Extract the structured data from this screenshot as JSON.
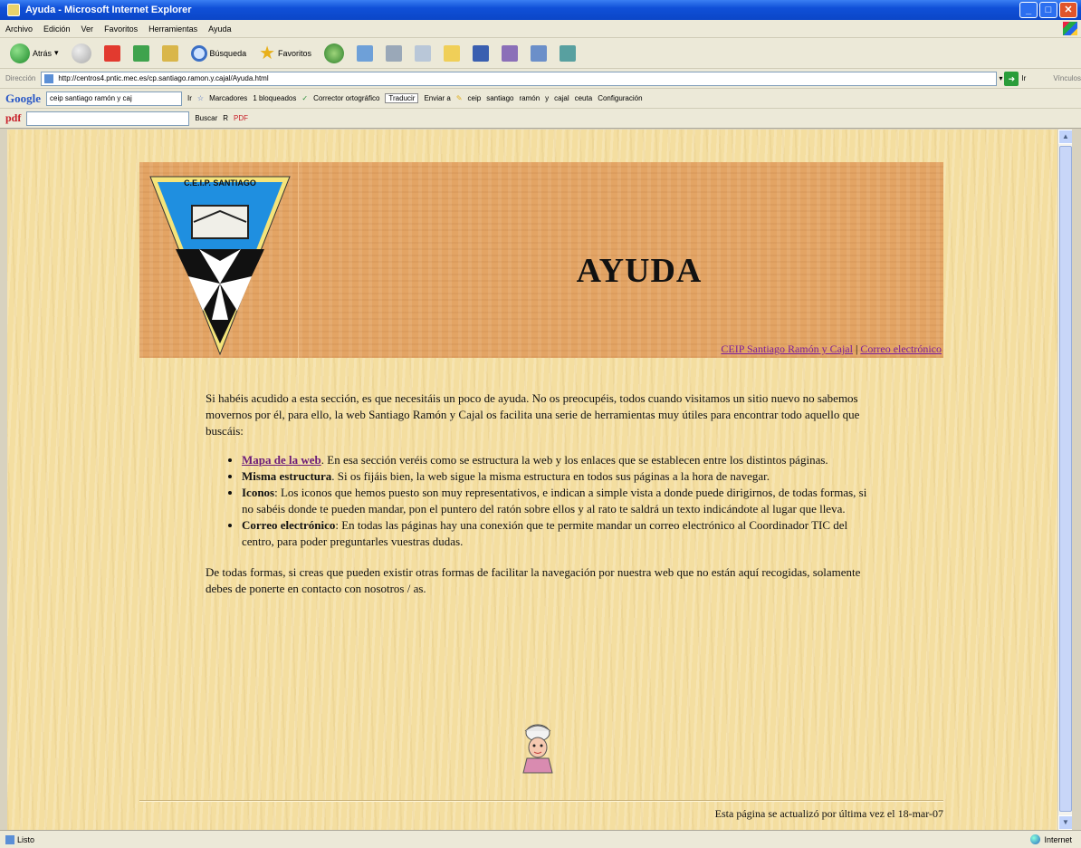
{
  "window": {
    "title": "Ayuda - Microsoft Internet Explorer",
    "controls": [
      "_",
      "□",
      "✕"
    ]
  },
  "menu": [
    "Archivo",
    "Edición",
    "Ver",
    "Favoritos",
    "Herramientas",
    "Ayuda"
  ],
  "toolbar": {
    "back_label": "Atrás",
    "search_label": "Búsqueda",
    "favorites_label": "Favoritos"
  },
  "address": {
    "label": "Dirección",
    "url": "http://centros4.pntic.mec.es/cp.santiago.ramon.y.cajal/Ayuda.html",
    "go_label": "Ir",
    "links_label": "Vínculos"
  },
  "google_bar": {
    "logo": "Google",
    "search_value": "ceip santiago ramón y caj",
    "go_label": "Ir",
    "items": [
      "Marcadores",
      "1 bloqueados",
      "Corrector ortográfico",
      "Traducir",
      "Enviar a",
      "ceip",
      "santiago",
      "ramón",
      "y",
      "cajal",
      "ceuta",
      "Configuración"
    ]
  },
  "pdf_bar": {
    "logo": "pdf",
    "search_label": "Buscar",
    "items": [
      "R",
      "PDF"
    ]
  },
  "page": {
    "title": "AYUDA",
    "header_links": {
      "school": "CEIP Santiago Ramón y Cajal",
      "separator": "|",
      "email": "Correo electrónico"
    },
    "intro": "Si habéis acudido a esta sección, es que necesitáis un poco de ayuda. No os preocupéis, todos cuando visitamos un sitio nuevo no sabemos movernos por él, para ello, la web Santiago Ramón y Cajal os facilita una serie de herramientas muy útiles para encontrar todo aquello que buscáis:",
    "items": [
      {
        "term": "Mapa de la web",
        "text": ". En esa sección veréis como se estructura la web y los enlaces que se establecen entre los distintos páginas."
      },
      {
        "term": "Misma estructura",
        "text": ". Si os fijáis bien, la web sigue la misma estructura en todos sus páginas a la hora de navegar."
      },
      {
        "term": "Iconos",
        "text": ": Los iconos que hemos puesto son muy representativos, e indican a simple vista a donde puede dirigirnos, de todas formas, si no sabéis donde te pueden mandar, pon el puntero del ratón sobre ellos y al rato te saldrá un texto indicándote al lugar que lleva."
      },
      {
        "term": "Correo electrónico",
        "text": ": En todas las páginas hay una conexión que te permite mandar un correo electrónico al Coordinador TIC del centro, para poder preguntarles vuestras dudas."
      }
    ],
    "outro": "De todas formas, si creas que pueden existir otras formas de facilitar la navegación por nuestra web que no están aquí recogidas, solamente debes de ponerte en contacto con nosotros / as.",
    "footer": "Esta página se actualizó por última vez el 18-mar-07"
  },
  "logo": {
    "text": "C.E.I.P. SANTIAGO"
  },
  "status": {
    "left": "Listo",
    "zone": "Internet"
  },
  "colors": {
    "page_background": "#f4dea0",
    "banner": "#e3a464",
    "link": "#7a1e9a",
    "titlebar": "#0b46c7"
  }
}
